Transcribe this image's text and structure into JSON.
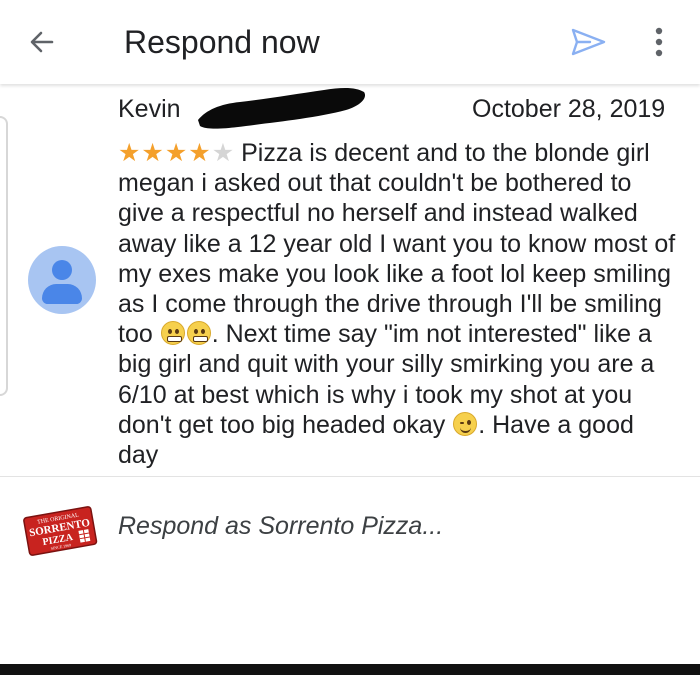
{
  "header": {
    "title": "Respond now",
    "back_icon": "arrow-left-icon",
    "send_icon": "send-icon",
    "more_icon": "more-vertical-icon"
  },
  "review": {
    "reviewer_name": "Kevin",
    "date": "October 28, 2019",
    "rating": 4,
    "max_rating": 5,
    "star_color": "#f4a02c",
    "text_part1": "Pizza is decent and to the blonde girl megan i asked out that couldn't be bothered to give a respectful no herself and instead walked away like a 12 year old I want you to know most of my exes make you look like a foot lol keep smiling as I come through the drive through I'll be smiling too ",
    "text_part2": ".  Next time say \"im not interested\" like a big girl and quit with your silly smirking you are a 6/10 at best which is why i took my shot at you don't get too big headed okay ",
    "text_part3": ". Have a good day"
  },
  "reply": {
    "placeholder": "Respond as Sorrento Pizza...",
    "logo_lines": [
      "THE ORIGINAL",
      "SORRENTO",
      "PIZZA",
      "SINCE 1969"
    ]
  }
}
